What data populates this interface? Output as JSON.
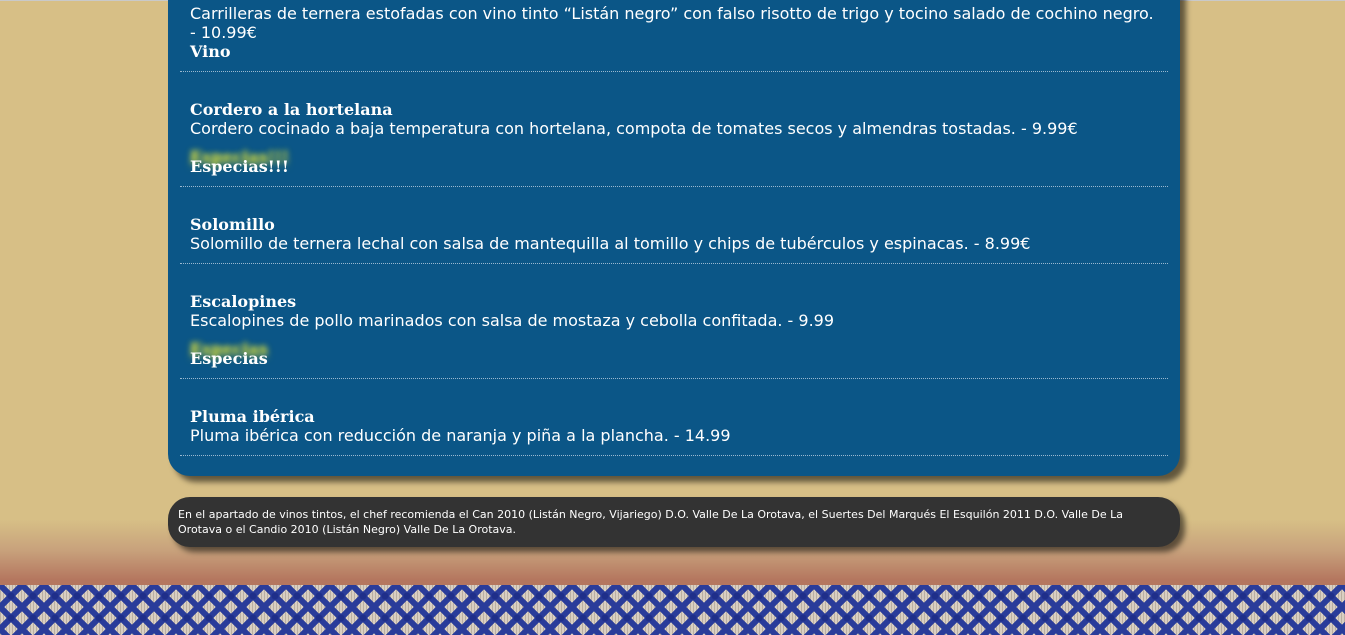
{
  "menu": {
    "dishes": [
      {
        "name": "",
        "description": "Carrilleras de ternera estofadas con vino tinto “Listán negro” con falso risotto de trigo y tocino salado de cochino negro. - 10.99€",
        "tag": "Vino"
      },
      {
        "name": "Cordero a la hortelana",
        "description": "Cordero cocinado a baja temperatura con hortelana, compota de tomates secos y almendras tostadas. - 9.99€",
        "tag": "Especias!!!"
      },
      {
        "name": "Solomillo",
        "description": "Solomillo de ternera lechal con salsa de mantequilla al tomillo y chips de tubérculos y espinacas. - 8.99€",
        "tag": ""
      },
      {
        "name": "Escalopines",
        "description": "Escalopines de pollo marinados con salsa de mostaza y cebolla confitada. - 9.99",
        "tag": "Especias"
      },
      {
        "name": "Pluma ibérica",
        "description": "Pluma ibérica con reducción de naranja y piña a la plancha. - 14.99",
        "tag": ""
      }
    ]
  },
  "wine_note": {
    "text": "En el apartado de vinos tintos, el chef recomienda el Can 2010 (Listán Negro, Vijariego) D.O. Valle De La Orotava, el Suertes Del Marqués El Esquilón 2011 D.O. Valle De La Orotava o el Candio 2010 (Listán Negro) Valle De La Orotava."
  },
  "colors": {
    "background": "#d7bf86",
    "menu_panel": "#0b5687",
    "note_panel": "#333333",
    "glow": "#ebeb3c"
  }
}
